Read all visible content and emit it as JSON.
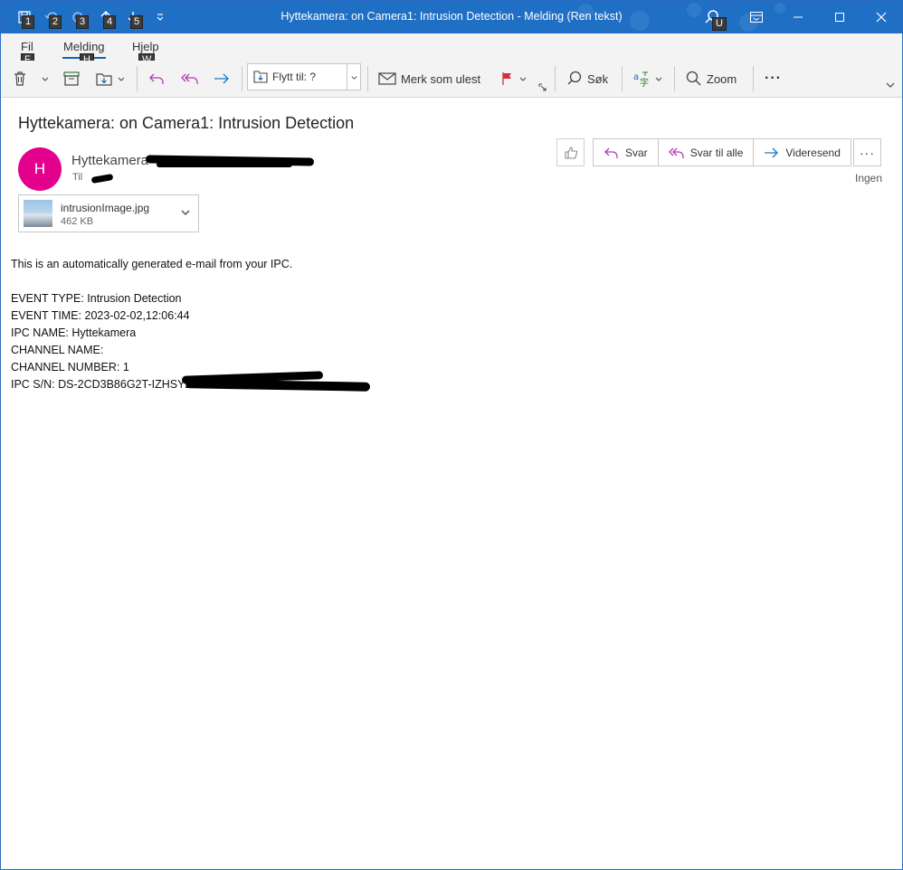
{
  "window": {
    "title": "Hyttekamera: on Camera1: Intrusion Detection  -  Melding (Ren tekst)",
    "qat_keytips": [
      "1",
      "2",
      "3",
      "4",
      "5"
    ],
    "search_keytip": "U"
  },
  "tabs": [
    {
      "label": "Fil",
      "keytip": "F"
    },
    {
      "label": "Melding",
      "keytip": "H"
    },
    {
      "label": "Hjelp",
      "keytip": "W"
    }
  ],
  "ribbon": {
    "move_to": "Flytt til: ?",
    "mark_unread": "Merk som ulest",
    "search": "Søk",
    "zoom": "Zoom",
    "more": "···"
  },
  "message": {
    "subject": "Hyttekamera: on Camera1: Intrusion Detection",
    "avatar_initial": "H",
    "sender": "Hyttekamera",
    "to_label": "Til",
    "reply": "Svar",
    "reply_all": "Svar til alle",
    "forward": "Videresend",
    "more": "···",
    "importance": "Ingen",
    "attachment": {
      "name": "intrusionImage.jpg",
      "size": "462 KB"
    },
    "body": [
      "This is an automatically generated e-mail from your IPC.",
      "",
      "EVENT TYPE: Intrusion Detection",
      "EVENT TIME: 2023-02-02,12:06:44",
      "IPC NAME: Hyttekamera",
      "CHANNEL NAME:",
      "CHANNEL NUMBER: 1",
      "IPC S/N: DS-2CD3B86G2T-IZHSY2"
    ]
  },
  "colors": {
    "titlebar": "#1f6fc5",
    "accent": "#1a61b8",
    "avatar": "#e3008c",
    "reply_icon": "#b13eb0",
    "forward_icon": "#1a78c2",
    "flag": "#d13438"
  }
}
